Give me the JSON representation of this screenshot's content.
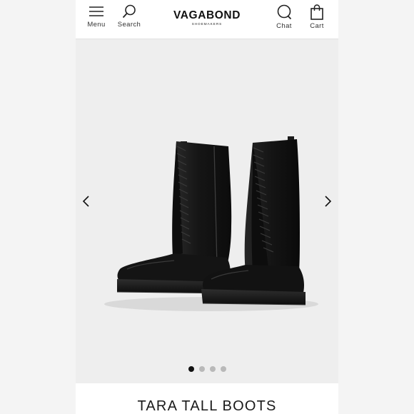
{
  "header": {
    "menu_label": "Menu",
    "search_label": "Search",
    "brand": "VAGABOND",
    "brand_sub": "SHOEMAKERS",
    "chat_label": "Chat",
    "cart_label": "Cart"
  },
  "carousel": {
    "image_alt": "black-tall-lace-up-platform-boots",
    "slide_count": 4,
    "active_index": 0
  },
  "product": {
    "name": "TARA TALL BOOTS"
  },
  "colors": {
    "background": "#eeeeee",
    "text": "#1a1a1a",
    "dot_active": "#111111",
    "dot_inactive": "#b9b9b9"
  }
}
